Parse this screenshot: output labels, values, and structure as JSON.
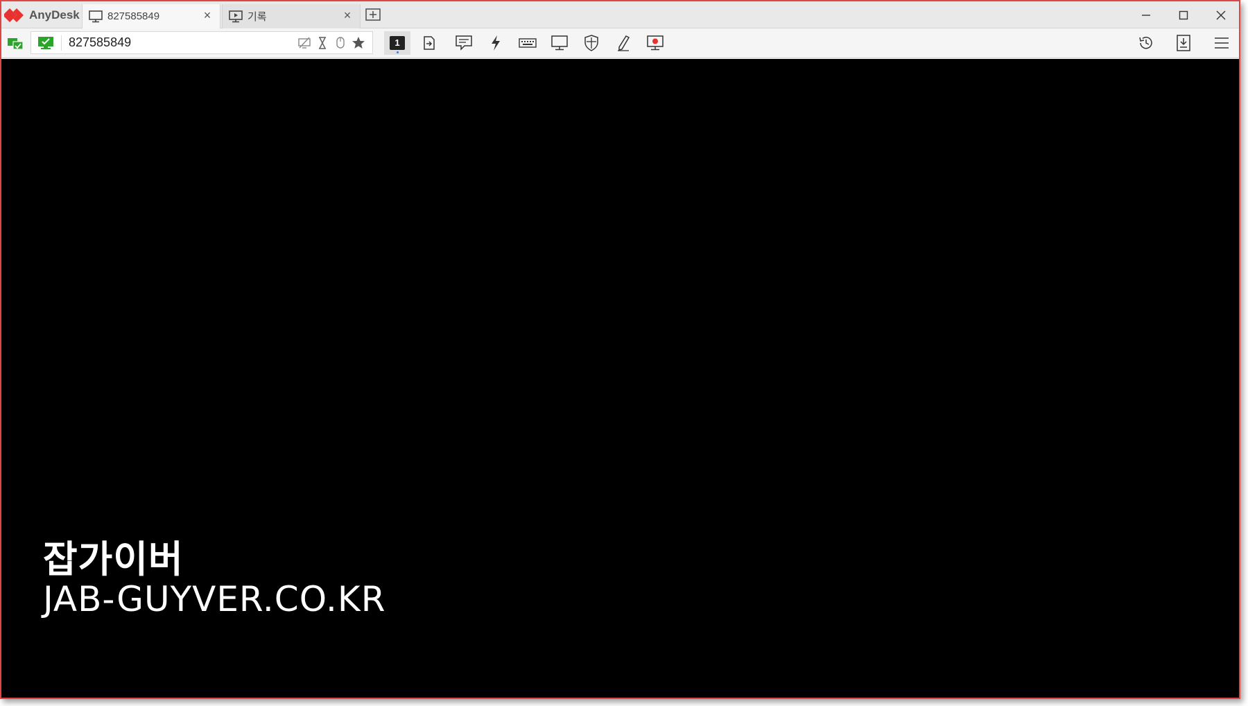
{
  "app": {
    "name": "AnyDesk",
    "accent_color": "#e8322f",
    "status_color": "#2aa52a"
  },
  "tabs": [
    {
      "label": "827585849",
      "icon": "monitor-icon",
      "active": true
    },
    {
      "label": "기록",
      "icon": "play-screen-icon",
      "active": false
    }
  ],
  "toolbar": {
    "address_value": "827585849",
    "display_number": "1",
    "actions": [
      "display-icon",
      "transfer-icon",
      "chat-icon",
      "actions-icon",
      "keyboard-icon",
      "monitor-settings-icon",
      "permissions-shield-icon",
      "whiteboard-pen-icon",
      "record-session-icon"
    ],
    "right_actions": [
      "history-icon",
      "download-icon",
      "menu-icon"
    ]
  },
  "watermark": {
    "line1": "잡가이버",
    "line2": "JAB-GUYVER.CO.KR"
  }
}
